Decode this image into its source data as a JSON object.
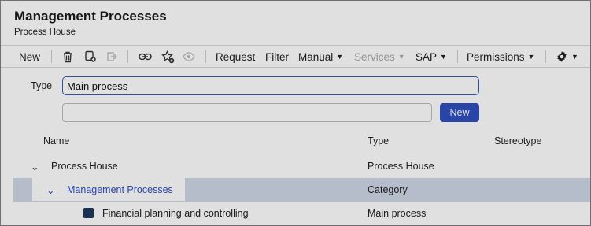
{
  "header": {
    "title": "Management Processes",
    "subtitle": "Process House"
  },
  "toolbar": {
    "new_label": "New",
    "request_label": "Request",
    "filter_label": "Filter",
    "manual_label": "Manual",
    "services_label": "Services",
    "sap_label": "SAP",
    "permissions_label": "Permissions",
    "icons": [
      "trash-icon",
      "copy-icon",
      "move-icon",
      "link-icon",
      "favorite-icon",
      "eye-icon",
      "gear-icon"
    ]
  },
  "form": {
    "type_label": "Type",
    "type_value": "Main process",
    "search_value": "",
    "new_button_label": "New"
  },
  "grid": {
    "columns": [
      "Name",
      "Type",
      "Stereotype"
    ],
    "rows": [
      {
        "name": "Process House",
        "type": "Process House",
        "stereotype": ""
      },
      {
        "name": "Management Processes",
        "type": "Category",
        "stereotype": ""
      },
      {
        "name": "Financial planning and controlling",
        "type": "Main process",
        "stereotype": ""
      }
    ]
  },
  "colors": {
    "accent": "#2f4fbf",
    "selected_row": "#cfd7e6",
    "link_text": "#2c4fc4",
    "item_square": "#1d3a5e"
  }
}
